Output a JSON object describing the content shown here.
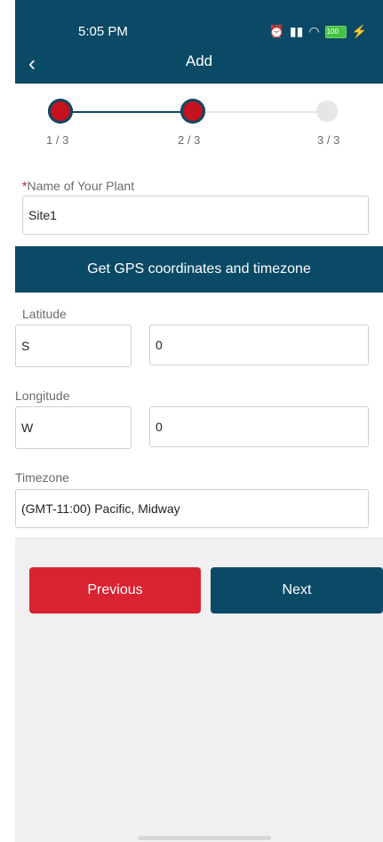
{
  "status": {
    "time": "5:05 PM",
    "battery": "100"
  },
  "header": {
    "title": "Add"
  },
  "stepper": {
    "steps": [
      "1 / 3",
      "2 / 3",
      "3 / 3"
    ],
    "current": 2
  },
  "plant": {
    "label": "Name of Your Plant",
    "required_mark": "*",
    "value": "Site1"
  },
  "gps_button": "Get GPS coordinates and timezone",
  "latitude": {
    "label": "Latitude",
    "hemisphere": "S",
    "value": "0"
  },
  "longitude": {
    "label": "Longitude",
    "hemisphere": "W",
    "value": "0"
  },
  "timezone": {
    "label": "Timezone",
    "value": "(GMT-11:00) Pacific, Midway"
  },
  "buttons": {
    "previous": "Previous",
    "next": "Next"
  },
  "colors": {
    "primary": "#0b4a66",
    "danger": "#d92232",
    "step_active": "#c4121f"
  }
}
